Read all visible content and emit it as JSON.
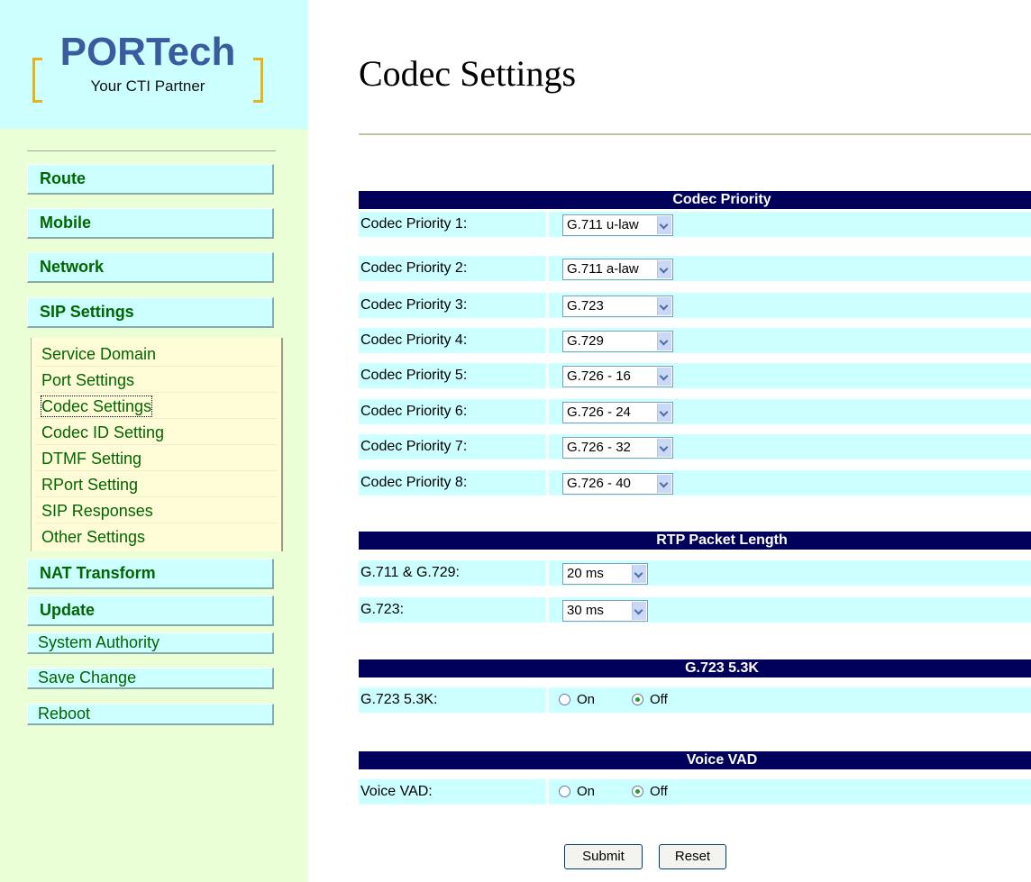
{
  "sidebar": {
    "logo": {
      "brand": "PORTech",
      "tagline": "Your CTI Partner"
    },
    "nav": [
      {
        "label": "Route"
      },
      {
        "label": "Mobile"
      },
      {
        "label": "Network"
      },
      {
        "label": "SIP Settings"
      }
    ],
    "sip_submenu": [
      {
        "label": "Service Domain"
      },
      {
        "label": "Port Settings"
      },
      {
        "label": "Codec Settings",
        "active": true
      },
      {
        "label": "Codec ID Setting"
      },
      {
        "label": "DTMF Setting"
      },
      {
        "label": "RPort Setting"
      },
      {
        "label": "SIP Responses"
      },
      {
        "label": "Other Settings"
      }
    ],
    "nav_bottom": [
      {
        "label": "NAT Transform"
      },
      {
        "label": "Update"
      },
      {
        "label": "System Authority"
      },
      {
        "label": "Save Change"
      },
      {
        "label": "Reboot"
      }
    ]
  },
  "main": {
    "title": "Codec Settings",
    "codec_priority": {
      "heading": "Codec Priority",
      "rows": [
        {
          "label": "Codec Priority 1:",
          "value": "G.711 u-law"
        },
        {
          "label": "Codec Priority 2:",
          "value": "G.711 a-law"
        },
        {
          "label": "Codec Priority 3:",
          "value": "G.723"
        },
        {
          "label": "Codec Priority 4:",
          "value": "G.729"
        },
        {
          "label": "Codec Priority 5:",
          "value": "G.726 - 16"
        },
        {
          "label": "Codec Priority 6:",
          "value": "G.726 - 24"
        },
        {
          "label": "Codec Priority 7:",
          "value": "G.726 - 32"
        },
        {
          "label": "Codec Priority 8:",
          "value": "G.726 - 40"
        }
      ]
    },
    "rtp_packet_length": {
      "heading": "RTP Packet Length",
      "rows": [
        {
          "label": "G.711 & G.729:",
          "value": "20 ms"
        },
        {
          "label": "G.723:",
          "value": "30 ms"
        }
      ]
    },
    "g723_53k": {
      "heading": "G.723 5.3K",
      "label": "G.723 5.3K:",
      "on_label": "On",
      "off_label": "Off",
      "selected": "Off"
    },
    "voice_vad": {
      "heading": "Voice VAD",
      "label": "Voice VAD:",
      "on_label": "On",
      "off_label": "Off",
      "selected": "Off"
    },
    "buttons": {
      "submit": "Submit",
      "reset": "Reset"
    }
  }
}
